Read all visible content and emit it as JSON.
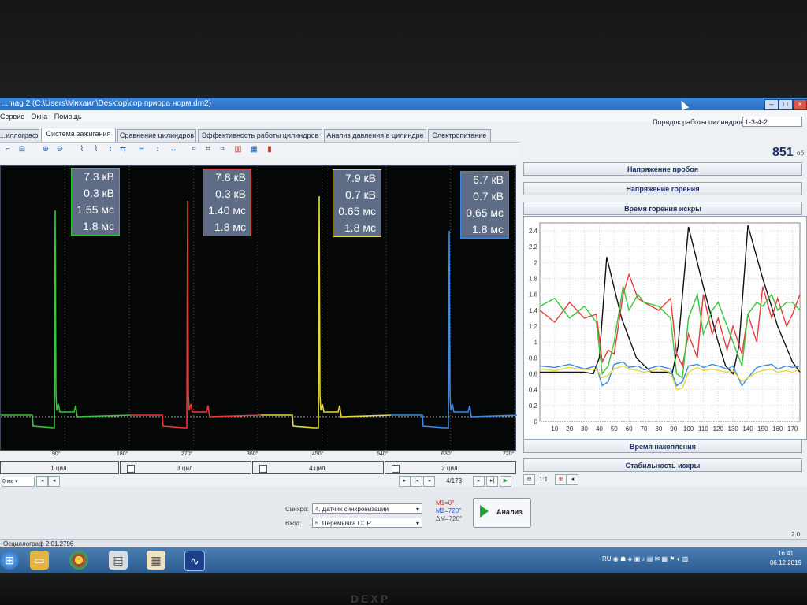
{
  "window": {
    "title": "...mag 2 (C:\\Users\\Михаил\\Desktop\\cop приора норм.dm2)"
  },
  "menu": [
    "Сервис",
    "Окна",
    "Помощь"
  ],
  "tabs": [
    "...иллограф",
    "Система зажигания",
    "Сравнение цилиндров",
    "Эффективность работы цилиндров",
    "Анализ давления в цилиндре",
    "Электропитание"
  ],
  "order": {
    "label": "Порядок работы цилиндров",
    "value": "1-3-4-2"
  },
  "rpm": {
    "value": "851",
    "unit": "об"
  },
  "cylinders": [
    {
      "label": "1 цил.",
      "color": "#3ac43a",
      "breakdown": "7.3 кВ",
      "burn_voltage": "0.3 кВ",
      "burn_time": "1.55 мс",
      "dwell": "1.8 мс"
    },
    {
      "label": "3 цил.",
      "color": "#e83a3a",
      "breakdown": "7.8 кВ",
      "burn_voltage": "0.3 кВ",
      "burn_time": "1.40 мс",
      "dwell": "1.8 мс"
    },
    {
      "label": "4 цил.",
      "color": "#e6d83a",
      "breakdown": "7.9 кВ",
      "burn_voltage": "0.7 кВ",
      "burn_time": "0.65 мс",
      "dwell": "1.8 мс"
    },
    {
      "label": "2 цил.",
      "color": "#3a8ae6",
      "breakdown": "6.7 кВ",
      "burn_voltage": "0.7 кВ",
      "burn_time": "0.65 мс",
      "dwell": "1.8 мс"
    }
  ],
  "degrees": [
    "90°",
    "180°",
    "270°",
    "360°",
    "450°",
    "540°",
    "630°",
    "720°"
  ],
  "nav": {
    "timebase": "0 мс",
    "page": "4/173",
    "zoom": "1:1"
  },
  "right_panels": {
    "breakdown_voltage": "Напряжение пробоя",
    "burn_voltage": "Напряжение горения",
    "burn_time": "Время горения искры",
    "dwell_time": "Время накопления",
    "spark_stability": "Стабильность искры"
  },
  "sync": {
    "label": "Синхро:",
    "value": "4. Датчик синхронизации"
  },
  "input": {
    "label": "Вход:",
    "value": "5. Перемычка СОР"
  },
  "markers": {
    "m1": "M1=0°",
    "m2": "M2=720°",
    "dm": "ΔM=720°"
  },
  "analyze_label": "Анализ",
  "status_text": "Осциллограф  2.01.2796",
  "version": "2.0",
  "taskbar": {
    "lang": "RU",
    "time": "16:41",
    "date": "06.12.2019"
  },
  "chart_data": {
    "type": "line",
    "title": "",
    "xlabel": "",
    "ylabel": "",
    "x_ticks": [
      10,
      20,
      30,
      40,
      50,
      60,
      70,
      80,
      90,
      100,
      110,
      120,
      130,
      140,
      150,
      160,
      170
    ],
    "y_ticks": [
      "0",
      "0.2",
      "0.4",
      "0.6",
      "0.8",
      "1",
      "1.2",
      "1.4",
      "1.6",
      "1.8",
      "2",
      "2.2",
      "2.4"
    ],
    "xlim": [
      0,
      175
    ],
    "ylim": [
      0,
      2.5
    ],
    "grid": true,
    "series": [
      {
        "color": "#111111",
        "x": [
          0,
          30,
          36,
          40,
          45,
          55,
          65,
          75,
          85,
          89,
          93,
          100,
          110,
          120,
          125,
          130,
          134,
          140,
          150,
          160,
          170,
          175
        ],
        "y": [
          0.62,
          0.62,
          0.6,
          0.8,
          2.07,
          1.3,
          0.8,
          0.62,
          0.62,
          0.6,
          0.95,
          2.45,
          1.7,
          1.0,
          0.7,
          0.6,
          0.95,
          2.47,
          1.8,
          1.2,
          0.75,
          0.62
        ]
      },
      {
        "color": "#e83a3a",
        "x": [
          0,
          10,
          20,
          30,
          38,
          42,
          46,
          50,
          56,
          60,
          66,
          70,
          80,
          88,
          92,
          96,
          100,
          106,
          110,
          116,
          120,
          126,
          130,
          136,
          140,
          146,
          150,
          156,
          160,
          166,
          170,
          175
        ],
        "y": [
          1.4,
          1.25,
          1.5,
          1.3,
          1.35,
          0.75,
          0.9,
          0.85,
          1.6,
          1.85,
          1.55,
          1.5,
          1.4,
          1.55,
          0.85,
          0.7,
          1.1,
          0.8,
          1.6,
          1.1,
          1.3,
          0.9,
          1.2,
          0.85,
          1.35,
          1.0,
          1.7,
          1.3,
          1.55,
          1.2,
          1.35,
          1.6
        ]
      },
      {
        "color": "#3ac43a",
        "x": [
          0,
          10,
          20,
          30,
          38,
          42,
          46,
          50,
          56,
          60,
          66,
          70,
          80,
          88,
          92,
          96,
          100,
          106,
          110,
          116,
          120,
          126,
          130,
          136,
          140,
          146,
          150,
          156,
          160,
          166,
          170,
          175
        ],
        "y": [
          1.45,
          1.55,
          1.3,
          1.45,
          1.25,
          0.6,
          0.7,
          1.0,
          1.7,
          1.4,
          1.6,
          1.5,
          1.45,
          1.3,
          0.6,
          0.55,
          1.3,
          1.6,
          1.1,
          1.4,
          1.5,
          1.2,
          1.0,
          0.7,
          1.35,
          1.5,
          1.45,
          1.6,
          1.4,
          1.5,
          1.5,
          1.4
        ]
      },
      {
        "color": "#3a8ae6",
        "x": [
          0,
          10,
          20,
          30,
          38,
          42,
          46,
          50,
          56,
          60,
          66,
          70,
          80,
          88,
          92,
          96,
          100,
          106,
          110,
          116,
          120,
          126,
          130,
          136,
          140,
          146,
          150,
          156,
          160,
          166,
          170,
          175
        ],
        "y": [
          0.7,
          0.68,
          0.72,
          0.66,
          0.7,
          0.45,
          0.5,
          0.72,
          0.75,
          0.68,
          0.7,
          0.65,
          0.7,
          0.66,
          0.45,
          0.5,
          0.7,
          0.72,
          0.68,
          0.72,
          0.7,
          0.66,
          0.7,
          0.45,
          0.55,
          0.68,
          0.7,
          0.72,
          0.66,
          0.7,
          0.68,
          0.7
        ]
      },
      {
        "color": "#e6d83a",
        "x": [
          0,
          10,
          20,
          30,
          38,
          42,
          46,
          50,
          56,
          60,
          66,
          70,
          80,
          88,
          92,
          96,
          100,
          106,
          110,
          116,
          120,
          126,
          130,
          136,
          140,
          146,
          150,
          156,
          160,
          166,
          170,
          175
        ],
        "y": [
          0.66,
          0.64,
          0.68,
          0.65,
          0.66,
          0.55,
          0.58,
          0.66,
          0.7,
          0.66,
          0.64,
          0.62,
          0.66,
          0.62,
          0.4,
          0.42,
          0.62,
          0.68,
          0.64,
          0.66,
          0.64,
          0.62,
          0.64,
          0.5,
          0.55,
          0.62,
          0.64,
          0.66,
          0.62,
          0.64,
          0.62,
          0.66
        ]
      }
    ]
  }
}
